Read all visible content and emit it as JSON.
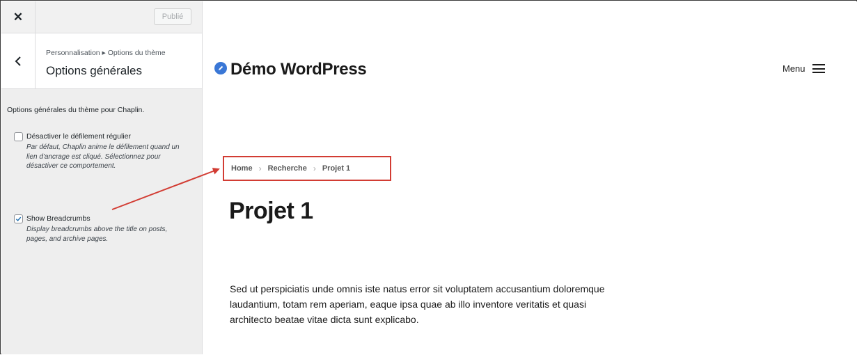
{
  "customizer": {
    "close_icon": "close-icon",
    "publish_label": "Publié",
    "breadcrumb": "Personnalisation ▸ Options du thème",
    "section_title": "Options générales",
    "description": "Options générales du thème pour Chaplin.",
    "options": [
      {
        "label": "Désactiver le défilement régulier",
        "description": "Par défaut, Chaplin anime le défilement quand un lien d'ancrage est cliqué. Sélectionnez pour désactiver ce comportement.",
        "checked": false
      },
      {
        "label": "Show Breadcrumbs",
        "description": "Display breadcrumbs above the title on posts, pages, and archive pages.",
        "checked": true
      }
    ]
  },
  "preview": {
    "site_title": "Démo WordPress",
    "menu_label": "Menu",
    "breadcrumbs": [
      "Home",
      "Recherche",
      "Projet 1"
    ],
    "page_title": "Projet 1",
    "body_text": "Sed ut perspiciatis unde omnis iste natus error sit voluptatem accusantium doloremque laudantium, totam rem aperiam, eaque ipsa quae ab illo inventore veritatis et quasi architecto beatae vitae dicta sunt explicabo."
  },
  "colors": {
    "accent": "#2271b1",
    "annotation": "#d23c33",
    "sidebar_bg": "#eeeeee",
    "logo": "#3a77d6"
  }
}
